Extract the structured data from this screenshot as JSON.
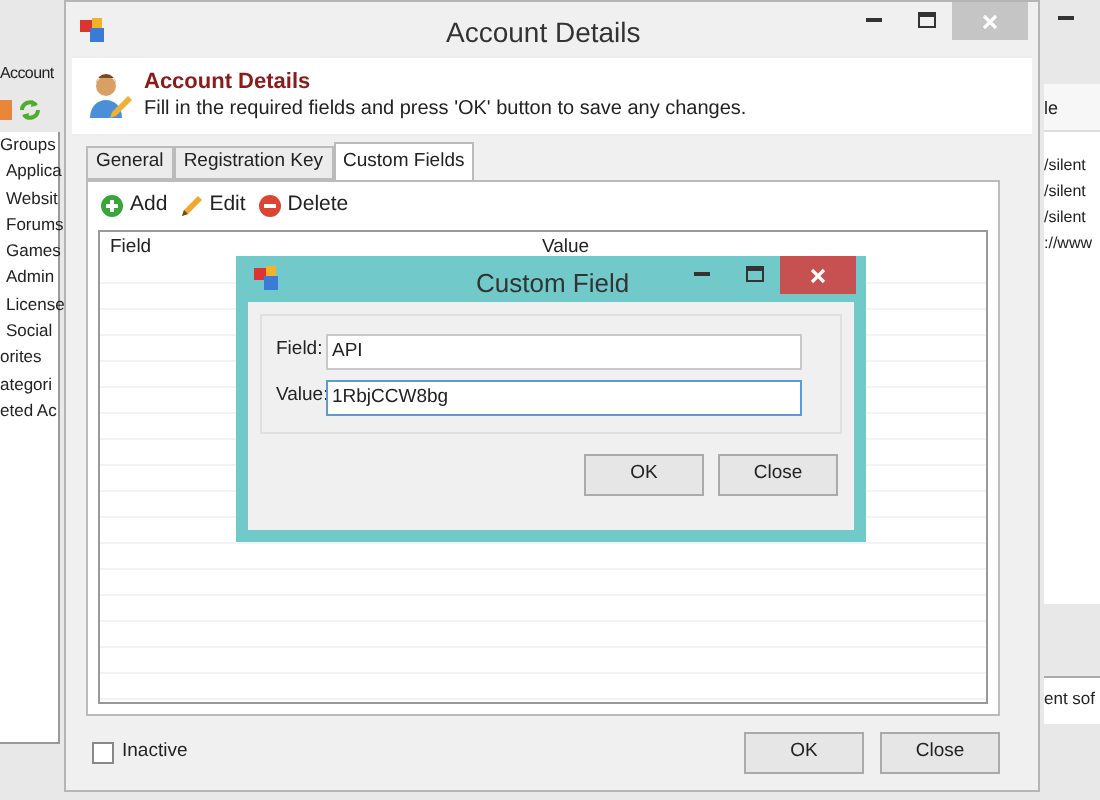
{
  "background_window": {
    "title": "Account",
    "tree_items": [
      {
        "label": "Groups",
        "children": [
          {
            "label": "Applica"
          },
          {
            "label": "Websit"
          },
          {
            "label": "Forums"
          },
          {
            "label": "Games"
          },
          {
            "label": "Admin"
          },
          {
            "label": "License"
          },
          {
            "label": "Social"
          }
        ]
      },
      {
        "label": "orites"
      },
      {
        "label": "ategori"
      },
      {
        "label": "eted Ac"
      }
    ],
    "column_header": "le",
    "rows": [
      "/silent",
      "/silent",
      "/silent",
      "://www"
    ],
    "detail_text": "ent sof"
  },
  "window": {
    "title": "Account Details",
    "header": {
      "title": "Account Details",
      "description": "Fill in the required fields and press 'OK' button to save any changes."
    },
    "tabs": [
      {
        "label": "General",
        "selected": false
      },
      {
        "label": "Registration Key",
        "selected": false
      },
      {
        "label": "Custom Fields",
        "selected": true
      }
    ],
    "toolbar": [
      {
        "label": "Add",
        "kind": "add"
      },
      {
        "label": "Edit",
        "kind": "edit"
      },
      {
        "label": "Delete",
        "kind": "delete"
      }
    ],
    "table": {
      "columns": [
        "Field",
        "Value"
      ]
    },
    "inactive": {
      "label": "Inactive",
      "checked": false
    },
    "buttons": [
      "OK",
      "Close"
    ]
  },
  "dialog": {
    "title": "Custom Field",
    "fields": [
      {
        "label": "Field:",
        "value": "API",
        "focused": false
      },
      {
        "label": "Value:",
        "value": "1RbjCCW8bg",
        "focused": true
      }
    ],
    "buttons": [
      "OK",
      "Close"
    ]
  }
}
